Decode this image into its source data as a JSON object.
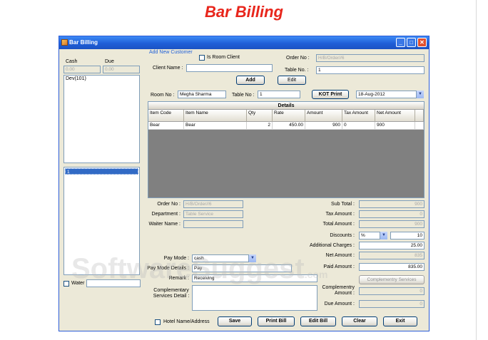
{
  "banner": "Bar Billing",
  "window": {
    "title": "Bar Billing",
    "controls": [
      "_",
      "□",
      "✕"
    ]
  },
  "left": {
    "cash_label": "Cash",
    "due_label": "Due",
    "cash_value": "0.00",
    "due_value": "0.00",
    "list_item": "Dev(101)",
    "selected_item": "1",
    "water_label": "Water"
  },
  "client": {
    "group_label": "Add New Customer",
    "is_room_client_label": "Is Room Client",
    "client_name_label": "Client Name :",
    "client_name": "",
    "order_no_label": "Order No :",
    "order_no": "H/B/Order//6",
    "table_no_label": "Table No. :",
    "table_no": "1",
    "add_button": "Add",
    "edit_button": "Edit"
  },
  "room": {
    "room_no_label": "Room No :",
    "room_no": "Megha Sharma",
    "table_no_label": "Table No :",
    "table_no": "1",
    "kot_button": "KOT Print",
    "date": "18-Aug-2012"
  },
  "details": {
    "title": "Details",
    "columns": [
      "Item Code",
      "Item Name",
      "Qty",
      "Rate",
      "Amount",
      "Tax Amount",
      "Net Amount"
    ],
    "rows": [
      [
        "Bear",
        "Bear",
        "2",
        "450.00",
        "900",
        "0",
        "900"
      ]
    ]
  },
  "order": {
    "order_no_label": "Order No :",
    "order_no": "H/B/Order//6",
    "department_label": "Department :",
    "department": "Table Service",
    "waiter_label": "Waiter Name :",
    "waiter": ""
  },
  "totals": {
    "sub_total_label": "Sub Total :",
    "sub_total": "900",
    "tax_label": "Tax Amount :",
    "tax": "0",
    "total_label": "Total Amount :",
    "total": "900",
    "discounts_label": "Discounts :",
    "discount_type": "%",
    "discount_value": "10",
    "additional_label": "Additional Charges :",
    "additional": "25.00",
    "net_label": "Net Amount :",
    "net": "835",
    "paid_label": "Paid Amount :",
    "paid": "835.00",
    "comp_services_button": "Complementry Services",
    "comp_amount_label": "Complementry Amount :",
    "comp_amount": "0",
    "due_label": "Due Amount :",
    "due": "0"
  },
  "payment": {
    "pay_mode_label": "Pay Mode :",
    "pay_mode": "cash",
    "pay_details_label": "Pay Mode Details :",
    "pay_details": "Pay",
    "remark_label": "Remark :",
    "remark": "Receiving",
    "comp_detail_label": "Complementary Services Detail :"
  },
  "footer": {
    "hotel_label": "Hotel Name/Address",
    "save": "Save",
    "print": "Print Bill",
    "edit": "Edit Bill",
    "clear": "Clear",
    "exit": "Exit"
  },
  "watermark": "SoftwareSuggest",
  "watermark_suffix": ".com"
}
